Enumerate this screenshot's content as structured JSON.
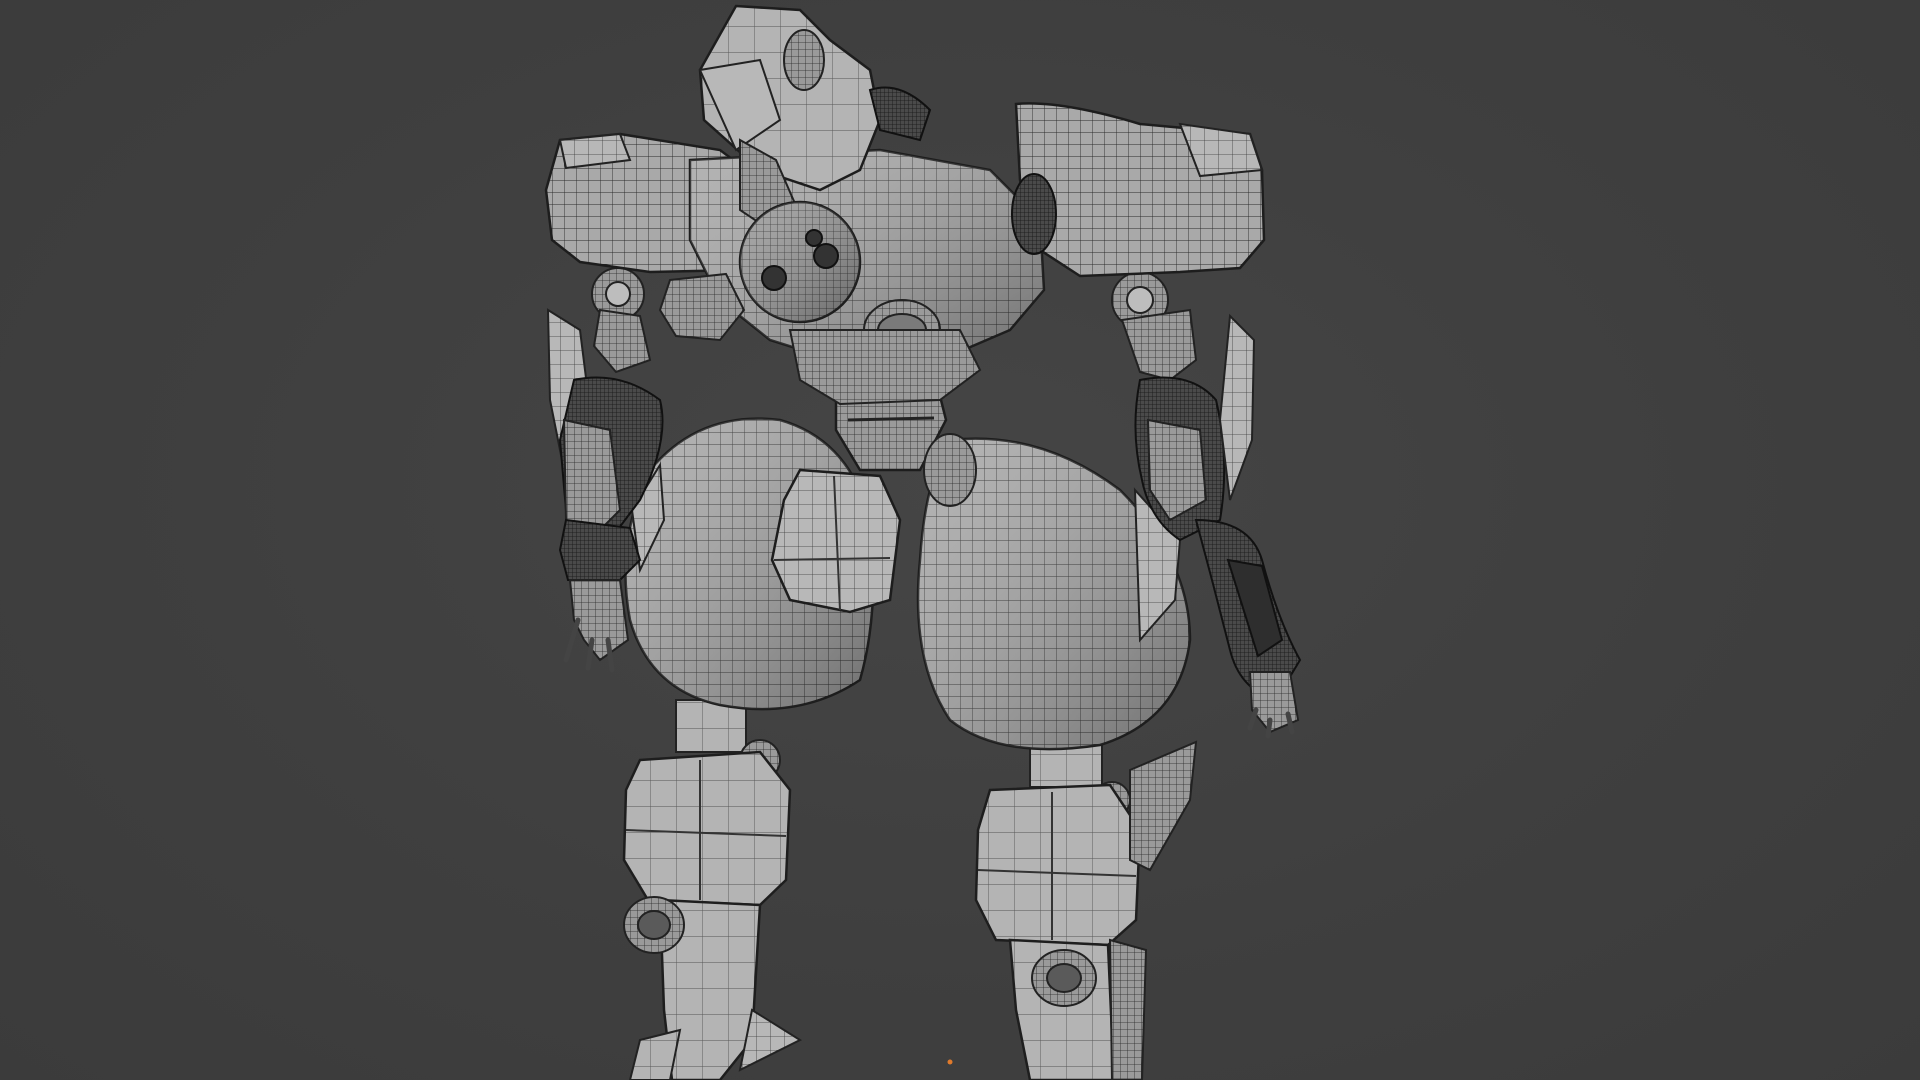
{
  "viewport": {
    "background": "#3e3e3e",
    "object": "robot-mech-wireframe-mesh",
    "shading": "solid-with-wireframe-overlay",
    "origin_marker_color": "#e07a2c"
  }
}
